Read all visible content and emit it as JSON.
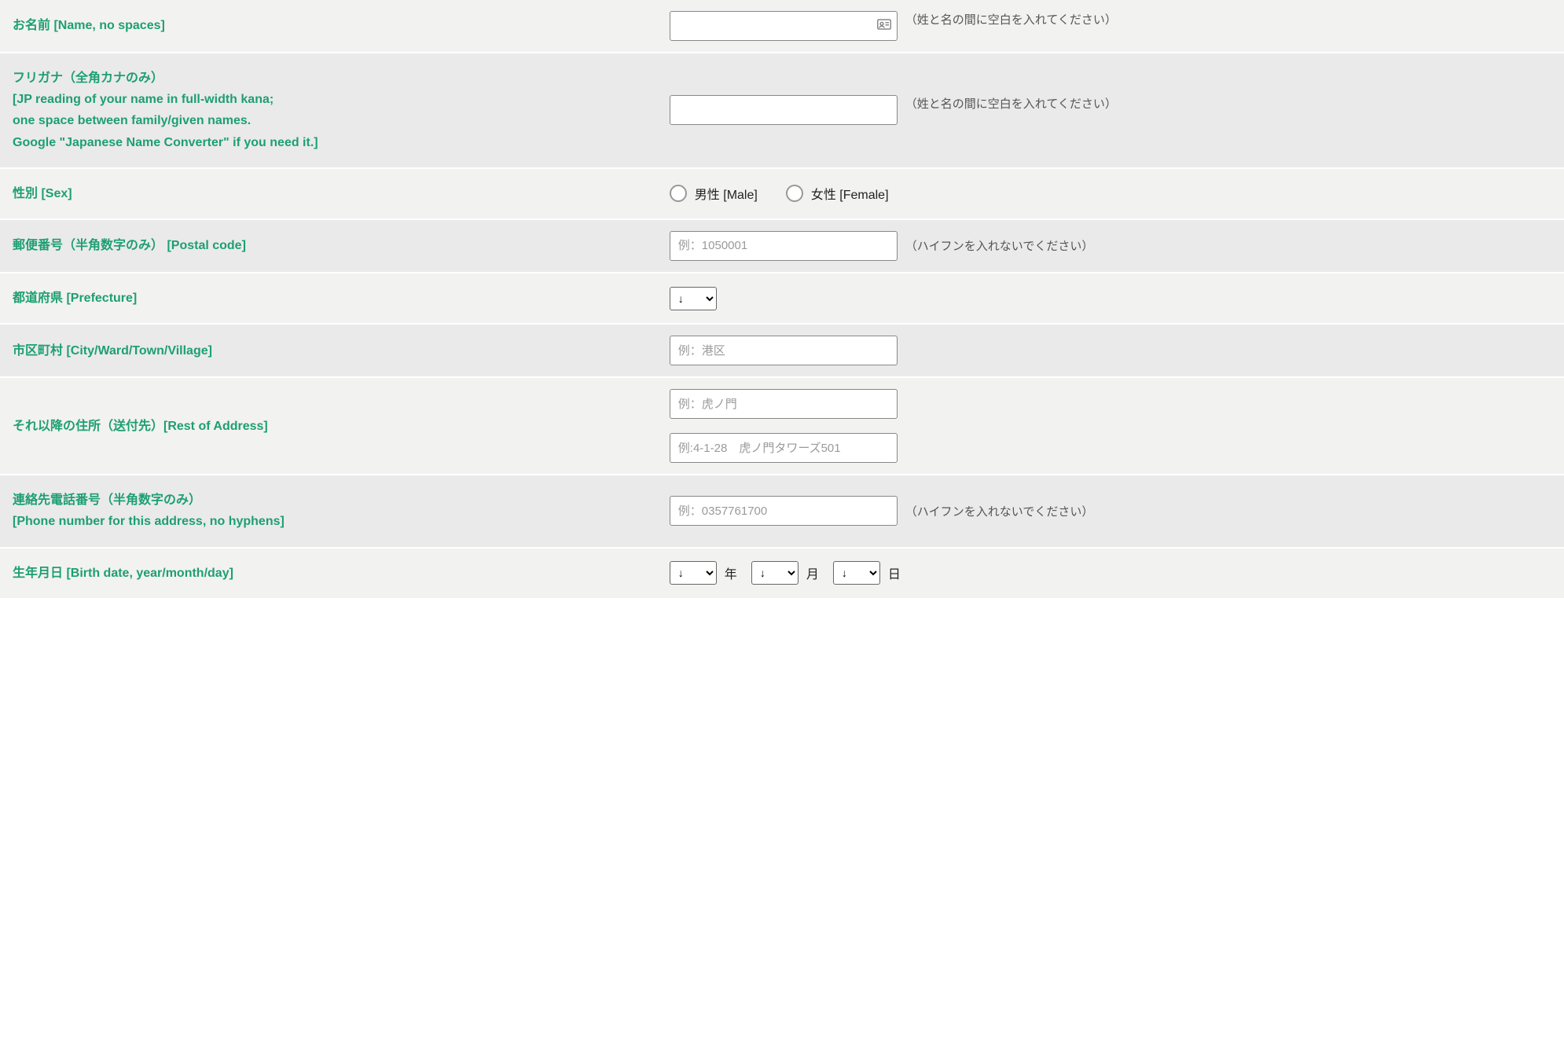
{
  "fields": {
    "name": {
      "label": "お名前 [Name, no spaces]",
      "hint": "（姓と名の間に空白を入れてください）"
    },
    "furigana": {
      "label_line1": "フリガナ（全角カナのみ）",
      "label_line2": "[JP reading of your name in full-width kana;",
      "label_line3": "one space between family/given names.",
      "label_line4": "Google \"Japanese Name Converter\" if you need it.]",
      "hint": "（姓と名の間に空白を入れてください）"
    },
    "sex": {
      "label": "性別 [Sex]",
      "male": "男性 [Male]",
      "female": "女性 [Female]"
    },
    "postal": {
      "label": "郵便番号（半角数字のみ） [Postal code]",
      "placeholder": "例：1050001",
      "hint": "（ハイフンを入れないでください）"
    },
    "prefecture": {
      "label": "都道府県 [Prefecture]",
      "selected": "↓"
    },
    "city": {
      "label": "市区町村 [City/Ward/Town/Village]",
      "placeholder": "例：港区"
    },
    "rest_address": {
      "label": "それ以降の住所（送付先）[Rest of Address]",
      "placeholder1": "例：虎ノ門",
      "placeholder2": "例:4-1-28　虎ノ門タワーズ501"
    },
    "phone": {
      "label_line1": "連絡先電話番号（半角数字のみ）",
      "label_line2": "[Phone number for this address, no hyphens]",
      "placeholder": "例：0357761700",
      "hint": "（ハイフンを入れないでください）"
    },
    "birthdate": {
      "label": "生年月日 [Birth date, year/month/day]",
      "year_selected": "↓",
      "year_suffix": "年",
      "month_selected": "↓",
      "month_suffix": "月",
      "day_selected": "↓",
      "day_suffix": "日"
    }
  }
}
